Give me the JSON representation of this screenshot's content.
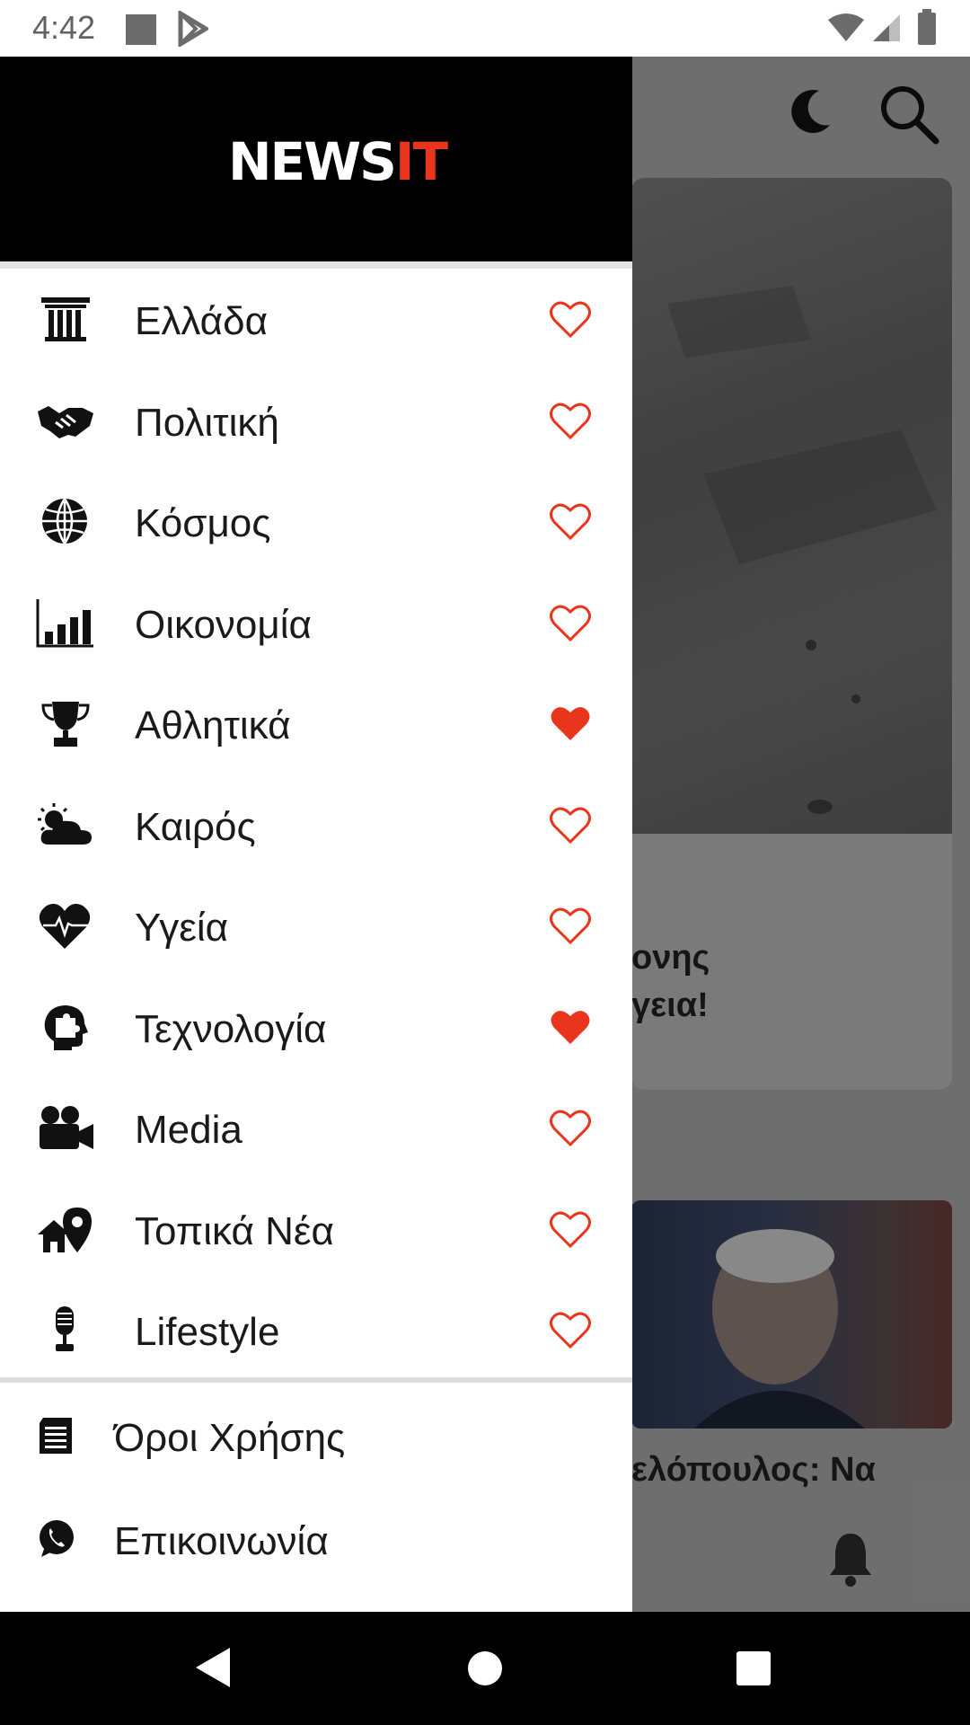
{
  "status_bar": {
    "time": "4:42"
  },
  "drawer": {
    "logo": {
      "part1": "NEWS",
      "part2": "IT"
    },
    "categories": [
      {
        "label": "Ελλάδα",
        "icon": "column-icon",
        "favorite": false
      },
      {
        "label": "Πολιτική",
        "icon": "handshake-icon",
        "favorite": false
      },
      {
        "label": "Κόσμος",
        "icon": "globe-icon",
        "favorite": false
      },
      {
        "label": "Οικονομία",
        "icon": "bar-chart-icon",
        "favorite": false
      },
      {
        "label": "Αθλητικά",
        "icon": "trophy-icon",
        "favorite": true
      },
      {
        "label": "Καιρός",
        "icon": "weather-icon",
        "favorite": false
      },
      {
        "label": "Υγεία",
        "icon": "heartbeat-icon",
        "favorite": false
      },
      {
        "label": "Τεχνολογία",
        "icon": "head-puzzle-icon",
        "favorite": true
      },
      {
        "label": "Media",
        "icon": "video-camera-icon",
        "favorite": false
      },
      {
        "label": "Τοπικά Νέα",
        "icon": "home-location-icon",
        "favorite": false
      },
      {
        "label": "Lifestyle",
        "icon": "microphone-icon",
        "favorite": false
      }
    ],
    "footer": [
      {
        "label": "Όροι Χρήσης",
        "icon": "document-icon"
      },
      {
        "label": "Επικοινωνία",
        "icon": "whatsapp-icon"
      }
    ]
  },
  "background": {
    "headline_fragment_1": "ονης",
    "headline_fragment_2": "γεια!",
    "headline_fragment_3": "ελόπουλος: Να"
  },
  "colors": {
    "accent": "#e8351b",
    "header_bg": "#000000"
  }
}
